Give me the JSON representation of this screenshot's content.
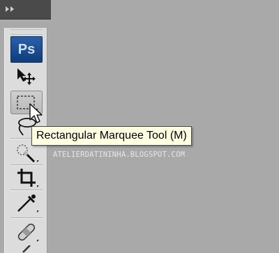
{
  "app": {
    "logo_text": "Ps"
  },
  "panel": {
    "collapse_icon": "double-chevron-right-icon"
  },
  "toolbar": {
    "tools": [
      {
        "name": "move-tool",
        "icon": "move-icon"
      },
      {
        "name": "rectangular-marquee-tool",
        "icon": "rectangular-marquee-icon",
        "active": true
      },
      {
        "name": "lasso-tool",
        "icon": "lasso-icon"
      },
      {
        "name": "quick-selection-tool",
        "icon": "quick-selection-icon"
      },
      {
        "name": "crop-tool",
        "icon": "crop-icon"
      },
      {
        "name": "eyedropper-tool",
        "icon": "eyedropper-icon"
      },
      {
        "name": "healing-brush-tool",
        "icon": "bandage-icon"
      }
    ]
  },
  "tooltip": {
    "text": "Rectangular Marquee Tool (M)"
  },
  "watermark": {
    "text": "ATELIERDATININHA.BLOGSPOT.COM"
  },
  "colors": {
    "canvas": "#a9a9a9",
    "toolbar": "#dcdcdc",
    "tooltip_bg": "#ffffe1",
    "ps_blue": "#1c4f96"
  }
}
